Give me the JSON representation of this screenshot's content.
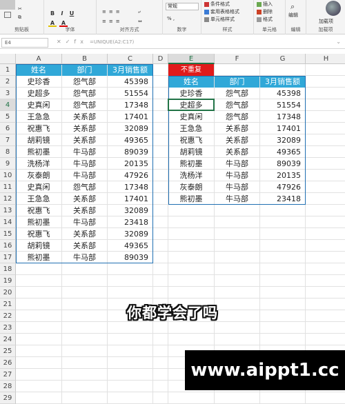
{
  "ribbon": {
    "groups": [
      {
        "title": "剪贴板"
      },
      {
        "title": "字体"
      },
      {
        "title": "对齐方式"
      },
      {
        "title": "数字"
      },
      {
        "title": "样式"
      },
      {
        "title": "单元格"
      },
      {
        "title": "编辑"
      },
      {
        "title": "加载项"
      }
    ],
    "buttons": {
      "cond_format": "条件格式",
      "table_format": "套用表格格式",
      "cell_style": "单元格样式",
      "insert": "插入",
      "delete": "删除",
      "format": "格式",
      "editing": "编辑",
      "addins": "加载项"
    },
    "font_buttons": [
      "B",
      "I",
      "U",
      "A",
      "A"
    ],
    "number_format": "常规"
  },
  "formula_bar": {
    "name_box": "E4",
    "fx_label": "fx",
    "formula": "=UNIQUE(A2:C17)"
  },
  "columns": [
    "A",
    "B",
    "C",
    "D",
    "E",
    "F",
    "G",
    "H"
  ],
  "rows": [
    "1",
    "2",
    "3",
    "4",
    "5",
    "6",
    "7",
    "8",
    "9",
    "10",
    "11",
    "12",
    "13",
    "14",
    "15",
    "16",
    "17",
    "18",
    "19",
    "20",
    "21",
    "22",
    "23",
    "24",
    "25",
    "26",
    "27",
    "28",
    "29"
  ],
  "left_table": {
    "headers": [
      "姓名",
      "部门",
      "3月销售额"
    ],
    "rows": [
      [
        "史珍香",
        "怨气部",
        "45398"
      ],
      [
        "史超多",
        "怨气部",
        "51554"
      ],
      [
        "史真闲",
        "怨气部",
        "17348"
      ],
      [
        "王急急",
        "关系部",
        "17401"
      ],
      [
        "祝惠飞",
        "关系部",
        "32089"
      ],
      [
        "胡莉镜",
        "关系部",
        "49365"
      ],
      [
        "熊初墨",
        "牛马部",
        "89039"
      ],
      [
        "洗杨洋",
        "牛马部",
        "20135"
      ],
      [
        "灰泰朗",
        "牛马部",
        "47926"
      ],
      [
        "史真闲",
        "怨气部",
        "17348"
      ],
      [
        "王急急",
        "关系部",
        "17401"
      ],
      [
        "祝惠飞",
        "关系部",
        "32089"
      ],
      [
        "熊初墨",
        "牛马部",
        "23418"
      ],
      [
        "祝惠飞",
        "关系部",
        "32089"
      ],
      [
        "胡莉镜",
        "关系部",
        "49365"
      ],
      [
        "熊初墨",
        "牛马部",
        "89039"
      ]
    ]
  },
  "right_table": {
    "label": "不重复",
    "headers": [
      "姓名",
      "部门",
      "3月销售额"
    ],
    "rows": [
      [
        "史珍香",
        "怨气部",
        "45398"
      ],
      [
        "史超多",
        "怨气部",
        "51554"
      ],
      [
        "史真闲",
        "怨气部",
        "17348"
      ],
      [
        "王急急",
        "关系部",
        "17401"
      ],
      [
        "祝惠飞",
        "关系部",
        "32089"
      ],
      [
        "胡莉镜",
        "关系部",
        "49365"
      ],
      [
        "熊初墨",
        "牛马部",
        "89039"
      ],
      [
        "洗杨洋",
        "牛马部",
        "20135"
      ],
      [
        "灰泰朗",
        "牛马部",
        "47926"
      ],
      [
        "熊初墨",
        "牛马部",
        "23418"
      ]
    ]
  },
  "overlay": {
    "subtitle": "你都学会了吗",
    "watermark": "www.aippt1.cc"
  },
  "colors": {
    "header_fill": "#30a8d8",
    "label_fill": "#e01b1b",
    "active_cell": "#217346"
  }
}
